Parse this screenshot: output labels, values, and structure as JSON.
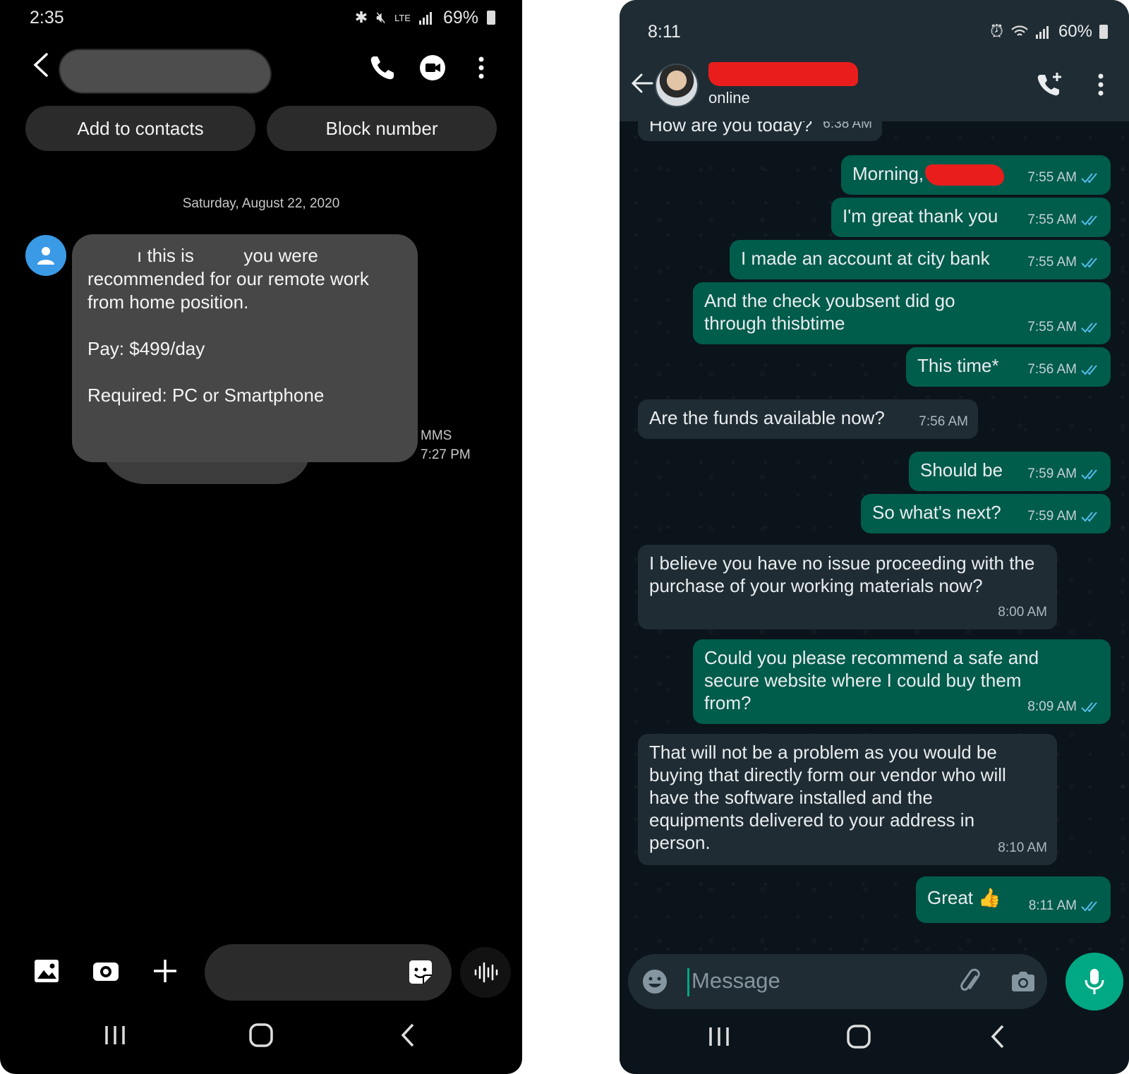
{
  "sms": {
    "status": {
      "time": "2:35",
      "network": "LTE",
      "battery": "69%"
    },
    "header": {
      "contact_name_redacted": true
    },
    "actions": {
      "add_contacts": "Add to contacts",
      "block_number": "Block number"
    },
    "date_divider": "Saturday, August 22, 2020",
    "message": {
      "line1_start": "ı this is ",
      "line1_end": " you were",
      "line2": "recommended for our remote work",
      "line3": "from home position.",
      "pay": "Pay: $499/day",
      "required": "Required: PC or Smartphone",
      "type": "MMS",
      "time": "7:27 PM"
    },
    "colors": {
      "avatar": "#3b9ae6",
      "bubble": "#474747",
      "background": "#000000"
    }
  },
  "whatsapp": {
    "status": {
      "time": "8:11",
      "battery": "60%"
    },
    "header": {
      "status": "online"
    },
    "messages": [
      {
        "dir": "in",
        "text": "How are you today?",
        "time": "6:38 AM"
      },
      {
        "dir": "out",
        "text": "Morning,",
        "time": "7:55 AM",
        "redacted_name": true
      },
      {
        "dir": "out",
        "text": "I'm great thank you",
        "time": "7:55 AM"
      },
      {
        "dir": "out",
        "text": "I made an account at city bank",
        "time": "7:55 AM"
      },
      {
        "dir": "out",
        "text": "And the check youbsent did go through thisbtime",
        "time": "7:55 AM"
      },
      {
        "dir": "out",
        "text": "This time*",
        "time": "7:56 AM"
      },
      {
        "dir": "in",
        "text": "Are the funds available now?",
        "time": "7:56 AM"
      },
      {
        "dir": "out",
        "text": "Should be",
        "time": "7:59 AM"
      },
      {
        "dir": "out",
        "text": "So what's next?",
        "time": "7:59 AM"
      },
      {
        "dir": "in",
        "text": "I believe you have no issue proceeding with the purchase of your working materials now?",
        "time": "8:00 AM"
      },
      {
        "dir": "out",
        "text": "Could you please recommend a safe and secure website where I could buy them from?",
        "time": "8:09 AM"
      },
      {
        "dir": "in",
        "text": "That will not be a problem as you would be buying that directly form our vendor who will have the software installed and the equipments delivered to your address in person.",
        "time": "8:10 AM"
      },
      {
        "dir": "out",
        "text": "Great 👍",
        "time": "8:11 AM"
      }
    ],
    "input": {
      "placeholder": "Message"
    },
    "colors": {
      "header": "#1f2c33",
      "incoming": "#1f2c33",
      "outgoing": "#005c4b",
      "accent": "#00a884",
      "read_ticks": "#53bdeb"
    }
  }
}
